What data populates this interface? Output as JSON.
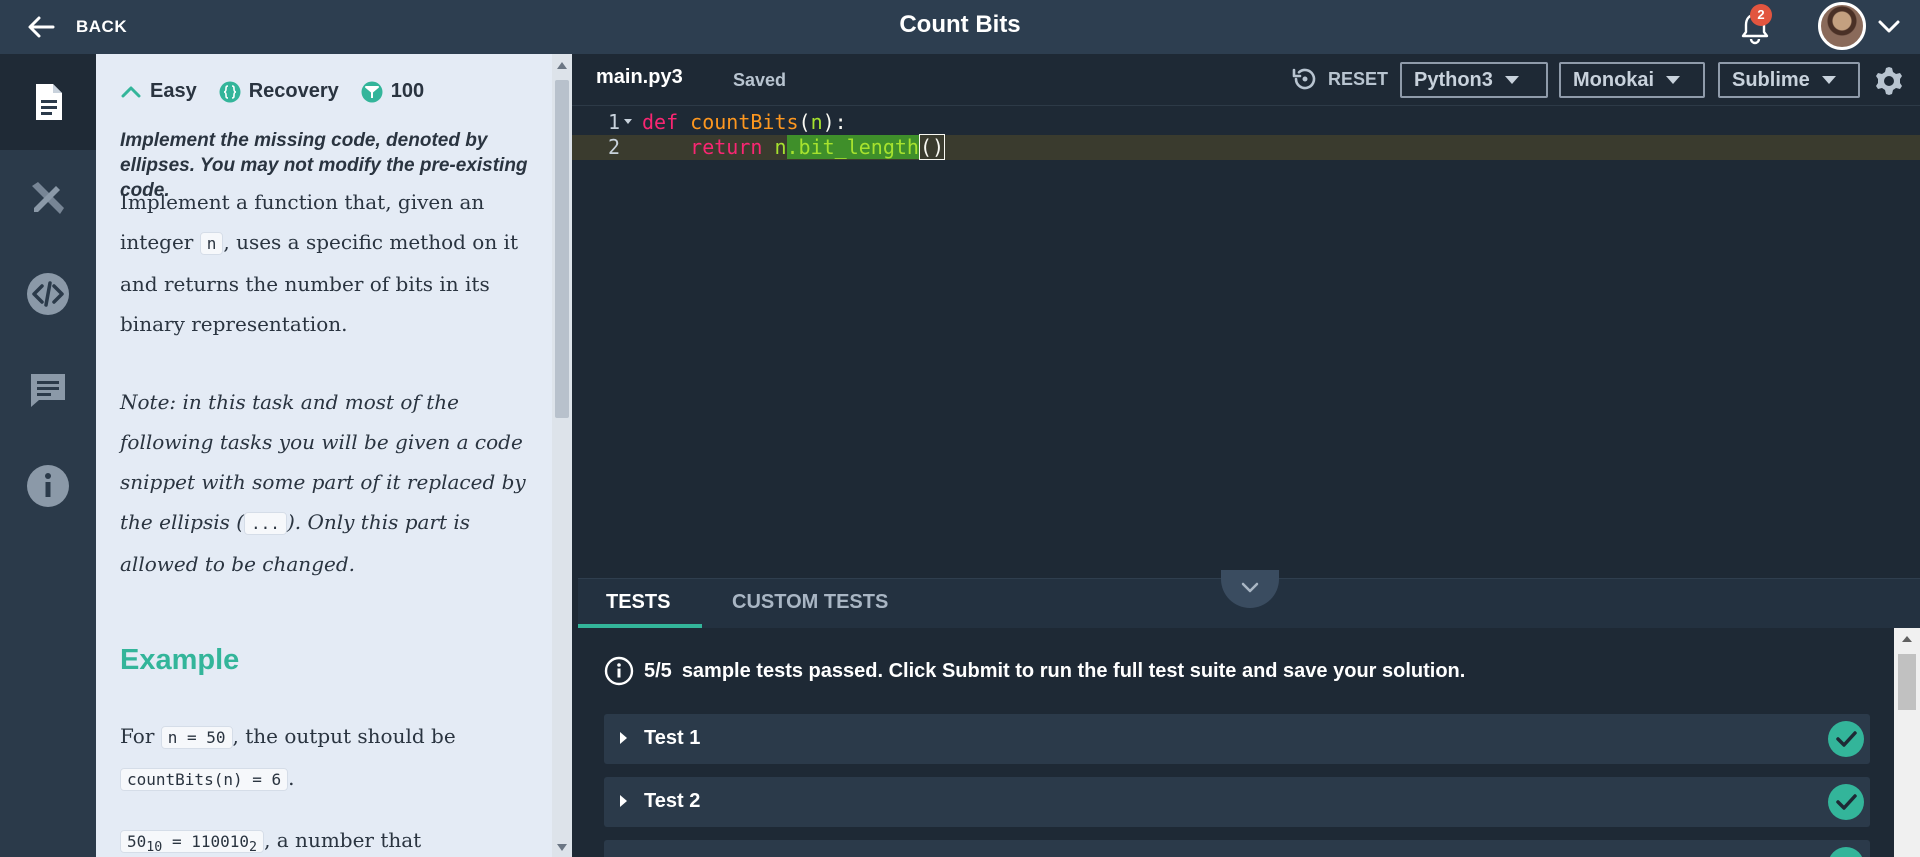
{
  "topbar": {
    "back_label": "BACK",
    "title": "Count Bits",
    "notification_count": "2"
  },
  "rail": {
    "items": [
      "description-icon",
      "solution-icon",
      "code-icon",
      "comments-icon",
      "info-icon"
    ]
  },
  "description": {
    "difficulty": "Easy",
    "category": "Recovery",
    "points": "100",
    "instruction": "Implement the missing code, denoted by ellipses. You may not modify the pre-existing code.",
    "p1_a": "Implement a function that, given an integer ",
    "p1_code": "n",
    "p1_b": ", uses a specific method on it and returns the number of bits in its binary representation.",
    "note_a": "Note: in this task and most of the following tasks you will be given a code snippet with some part of it replaced by the ellipsis (",
    "note_code": "...",
    "note_b": "). Only this part is allowed to be changed.",
    "example_heading": "Example",
    "ex_a": "For ",
    "ex_code1": "n = 50",
    "ex_b": ", the output should be ",
    "ex_code2": "countBits(n) = 6",
    "ex_c": ".",
    "ex2_code_a": "50",
    "ex2_sub_a": "10",
    "ex2_code_b": " = 110010",
    "ex2_sub_b": "2",
    "ex2_text": ", a number that"
  },
  "editor": {
    "file_tab": "main.py3",
    "status": "Saved",
    "reset_label": "RESET",
    "language": "Python3",
    "theme": "Monokai",
    "keymap": "Sublime",
    "lines": [
      {
        "num": "1",
        "kw": "def",
        "fn": "countBits",
        "open": "(",
        "param": "n",
        "close": "):"
      },
      {
        "num": "2",
        "kw": "return",
        "obj": "n",
        "method": ".bit_length",
        "call": "()"
      }
    ]
  },
  "tests": {
    "tab_tests": "TESTS",
    "tab_custom": "CUSTOM TESTS",
    "summary_bold": "5/5",
    "summary_text": "sample tests passed. Click Submit to run the full test suite and save your solution.",
    "items": [
      {
        "label": "Test 1",
        "status": "passed"
      },
      {
        "label": "Test 2",
        "status": "passed"
      },
      {
        "label": "",
        "status": "passed"
      }
    ]
  },
  "colors": {
    "accent": "#33b59a",
    "topbar": "#2d3e50",
    "editor_bg": "#1e2935",
    "badge": "#e2553f"
  }
}
